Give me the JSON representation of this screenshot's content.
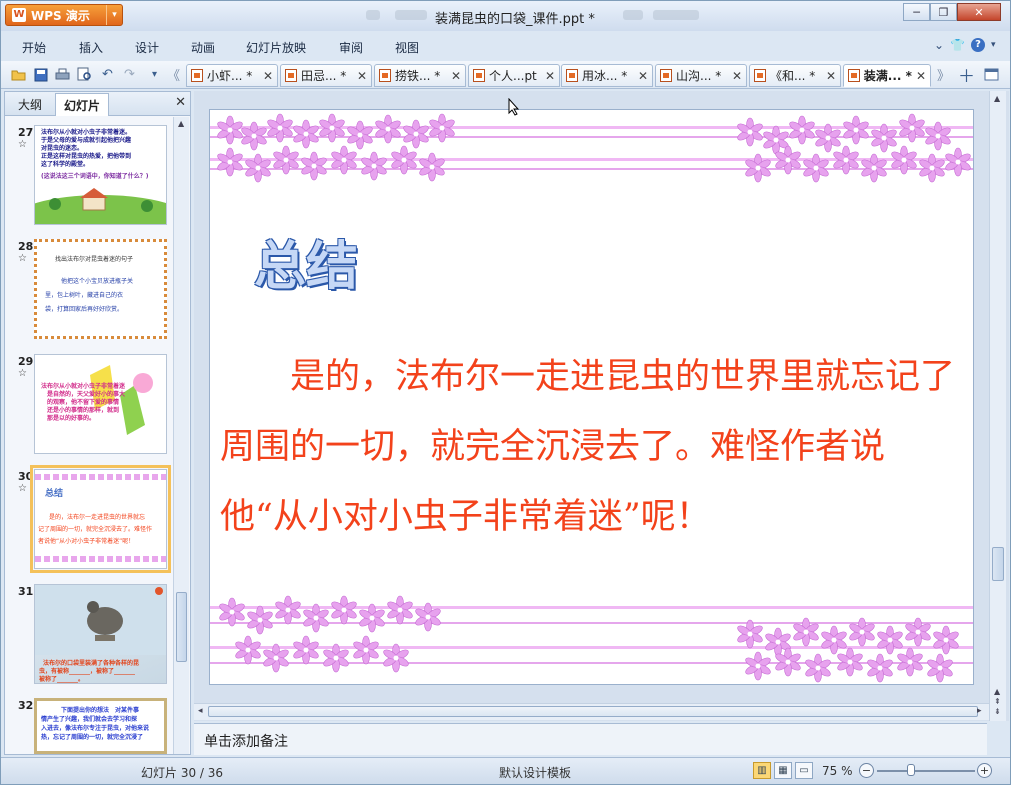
{
  "app": {
    "name": "WPS 演示",
    "doc_title": "装满昆虫的口袋_课件.ppt *"
  },
  "window_controls": {
    "minimize": "─",
    "restore": "❐",
    "close": "✕"
  },
  "menu": {
    "items": [
      "开始",
      "插入",
      "设计",
      "动画",
      "幻灯片放映",
      "审阅",
      "视图"
    ],
    "right": {
      "collapse": "⌄",
      "skin": "👕",
      "help": "?"
    }
  },
  "toolbar_icons": [
    "open-icon",
    "save-icon",
    "print-icon",
    "print-preview-icon",
    "undo-icon",
    "redo-icon",
    "more-icon"
  ],
  "tabs": [
    {
      "label": "小虾... *",
      "active": false
    },
    {
      "label": "田忌... *",
      "active": false
    },
    {
      "label": "捞铁... *",
      "active": false
    },
    {
      "label": "个人...pt",
      "active": false
    },
    {
      "label": "用冰... *",
      "active": false
    },
    {
      "label": "山沟... *",
      "active": false
    },
    {
      "label": "《和... *",
      "active": false
    },
    {
      "label": "装满... *",
      "active": true
    }
  ],
  "panel": {
    "tab_outline": "大纲",
    "tab_slides": "幻灯片",
    "close": "✕",
    "thumbnails": [
      {
        "num": "27",
        "star": "☆",
        "lines": [
          "法布尔从小就对小虫子非常着迷。",
          "于是父母的爱与成就引起他把兴趣",
          "对昆虫的迷恋。",
          "正是这样对昆虫的热爱，把他带到",
          "这了科学的殿堂。",
          "(这说法这三个词语中，你知道了什么？)"
        ]
      },
      {
        "num": "28",
        "star": "☆",
        "lines": [
          "找出法布尔对昆虫着迷的句子",
          "他把这个小宝贝放进瓶子关",
          "里，包上树叶，藏进自己的衣",
          "袋，打算回家后再好好欣赏。"
        ]
      },
      {
        "num": "29",
        "star": "☆",
        "lines": [
          "法布尔从小就对小虫子非常着迷",
          "是自然的，天父爱好小的事大",
          "的观察，他不留下爱的事情",
          "还是小的事情的那样，就到",
          "那是以的好事的。"
        ]
      },
      {
        "num": "30",
        "star": "☆",
        "lines": [
          "总结",
          "是的，法布尔一走进昆虫的世界就忘",
          "记了周围的一切，就完全沉浸去了。难怪作",
          "者说他“从小对小虫子非常着迷”呢！"
        ]
      },
      {
        "num": "31",
        "star": "",
        "lines": [
          "法布尔的口袋里装满了各种各样的昆",
          "虫，有被称_______，被称了_______",
          "被称了_______。"
        ]
      },
      {
        "num": "32",
        "star": "",
        "lines": [
          "下面提出你的想法　对某件事",
          "情产生了兴趣，我们就会去学习和探",
          "入进去，像法布尔专注于昆虫，对他来说",
          "热，忘记了周围的一切，就完全沉浸了"
        ]
      }
    ]
  },
  "slide": {
    "title": "总结",
    "body": "是的，法布尔一走进昆虫的世界里就忘记了周围的一切，就完全沉浸去了。难怪作者说他“从小对小虫子非常着迷”呢！"
  },
  "notes_placeholder": "单击添加备注",
  "status": {
    "slide_counter": "幻灯片 30 / 36",
    "template": "默认设计模板",
    "zoom": "75 %",
    "zoom_out": "−",
    "zoom_in": "+"
  }
}
